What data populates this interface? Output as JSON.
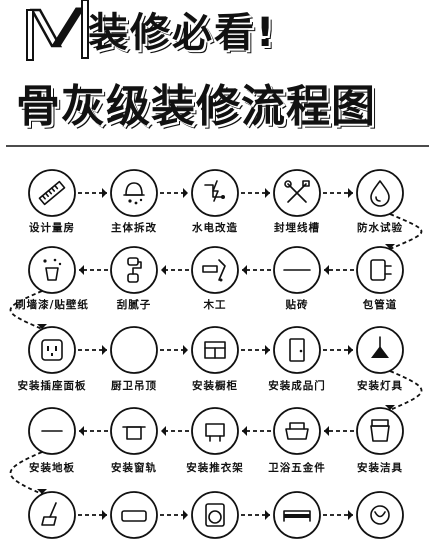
{
  "header": {
    "title_line_1": "装修必看!",
    "title_line_2": "骨灰级装修流程图"
  },
  "steps": [
    {
      "label": "设计量房",
      "icon": "ruler-icon"
    },
    {
      "label": "主体拆改",
      "icon": "demolition-icon"
    },
    {
      "label": "水电改造",
      "icon": "plumbing-electric-icon"
    },
    {
      "label": "封埋线槽",
      "icon": "tools-icon"
    },
    {
      "label": "防水试验",
      "icon": "water-drop-icon"
    },
    {
      "label": "包管道",
      "icon": "pipe-wrap-icon"
    },
    {
      "label": "贴砖",
      "icon": "tile-icon"
    },
    {
      "label": "木工",
      "icon": "carpentry-icon"
    },
    {
      "label": "刮腻子",
      "icon": "paint-roller-icon"
    },
    {
      "label": "刷墙漆/贴壁纸",
      "icon": "paint-bucket-icon"
    },
    {
      "label": "安装插座面板",
      "icon": "socket-icon"
    },
    {
      "label": "厨卫吊顶",
      "icon": "ceiling-icon"
    },
    {
      "label": "安装橱柜",
      "icon": "cabinet-icon"
    },
    {
      "label": "安装成品门",
      "icon": "door-icon"
    },
    {
      "label": "安装灯具",
      "icon": "lamp-icon"
    },
    {
      "label": "安装洁具",
      "icon": "toilet-icon"
    },
    {
      "label": "卫浴五金件",
      "icon": "bathroom-fixture-icon"
    },
    {
      "label": "安装推衣架",
      "icon": "clothes-rack-icon"
    },
    {
      "label": "安装窗轨",
      "icon": "window-rail-icon"
    },
    {
      "label": "安装地板",
      "icon": "floor-icon"
    },
    {
      "label": "",
      "icon": "cleaning-icon"
    },
    {
      "label": "",
      "icon": "sofa-icon"
    },
    {
      "label": "",
      "icon": "washing-machine-icon"
    },
    {
      "label": "",
      "icon": "bed-icon"
    },
    {
      "label": "",
      "icon": "decor-icon"
    }
  ]
}
